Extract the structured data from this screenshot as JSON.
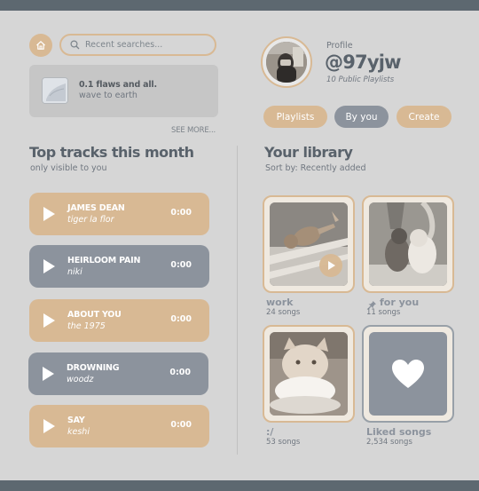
{
  "search": {
    "placeholder": "Recent searches..."
  },
  "recent": {
    "title": "0.1 flaws and all.",
    "subtitle": "wave to earth",
    "see_more": "SEE MORE..."
  },
  "top_tracks": {
    "title": "Top tracks this month",
    "subtitle": "only visible to you",
    "tracks": [
      {
        "title": "JAMES DEAN",
        "artist": "tiger la flor",
        "time": "0:00",
        "color": "#d8b994"
      },
      {
        "title": "HEIRLOOM PAIN",
        "artist": "niki",
        "time": "0:00",
        "color": "#8c939d"
      },
      {
        "title": "ABOUT YOU",
        "artist": "the 1975",
        "time": "0:00",
        "color": "#d8b994"
      },
      {
        "title": "DROWNING",
        "artist": "woodz",
        "time": "0:00",
        "color": "#8c939d"
      },
      {
        "title": "SAY",
        "artist": "keshi",
        "time": "0:00",
        "color": "#d8b994"
      }
    ]
  },
  "profile": {
    "label": "Profile",
    "handle": "@97yjw",
    "playlists": "10 Public Playlists"
  },
  "tabs": [
    {
      "label": "Playlists",
      "active": false
    },
    {
      "label": "By you",
      "active": true
    },
    {
      "label": "Create",
      "active": false
    }
  ],
  "library": {
    "title": "Your library",
    "sort": "Sort by: Recently added",
    "items": [
      {
        "name": "work",
        "count": "24 songs",
        "pinned": false
      },
      {
        "name": "for you",
        "count": "11 songs",
        "pinned": true
      },
      {
        "name": ":/",
        "count": "53 songs",
        "pinned": false
      },
      {
        "name": "Liked songs",
        "count": "2,534 songs",
        "pinned": false
      }
    ]
  },
  "colors": {
    "accent": "#d8b994",
    "slate": "#8c939d",
    "background": "#d6d6d6",
    "frame": "#5d6870"
  },
  "icons": [
    "home-icon",
    "search-icon",
    "play-icon",
    "pin-icon",
    "heart-icon"
  ]
}
